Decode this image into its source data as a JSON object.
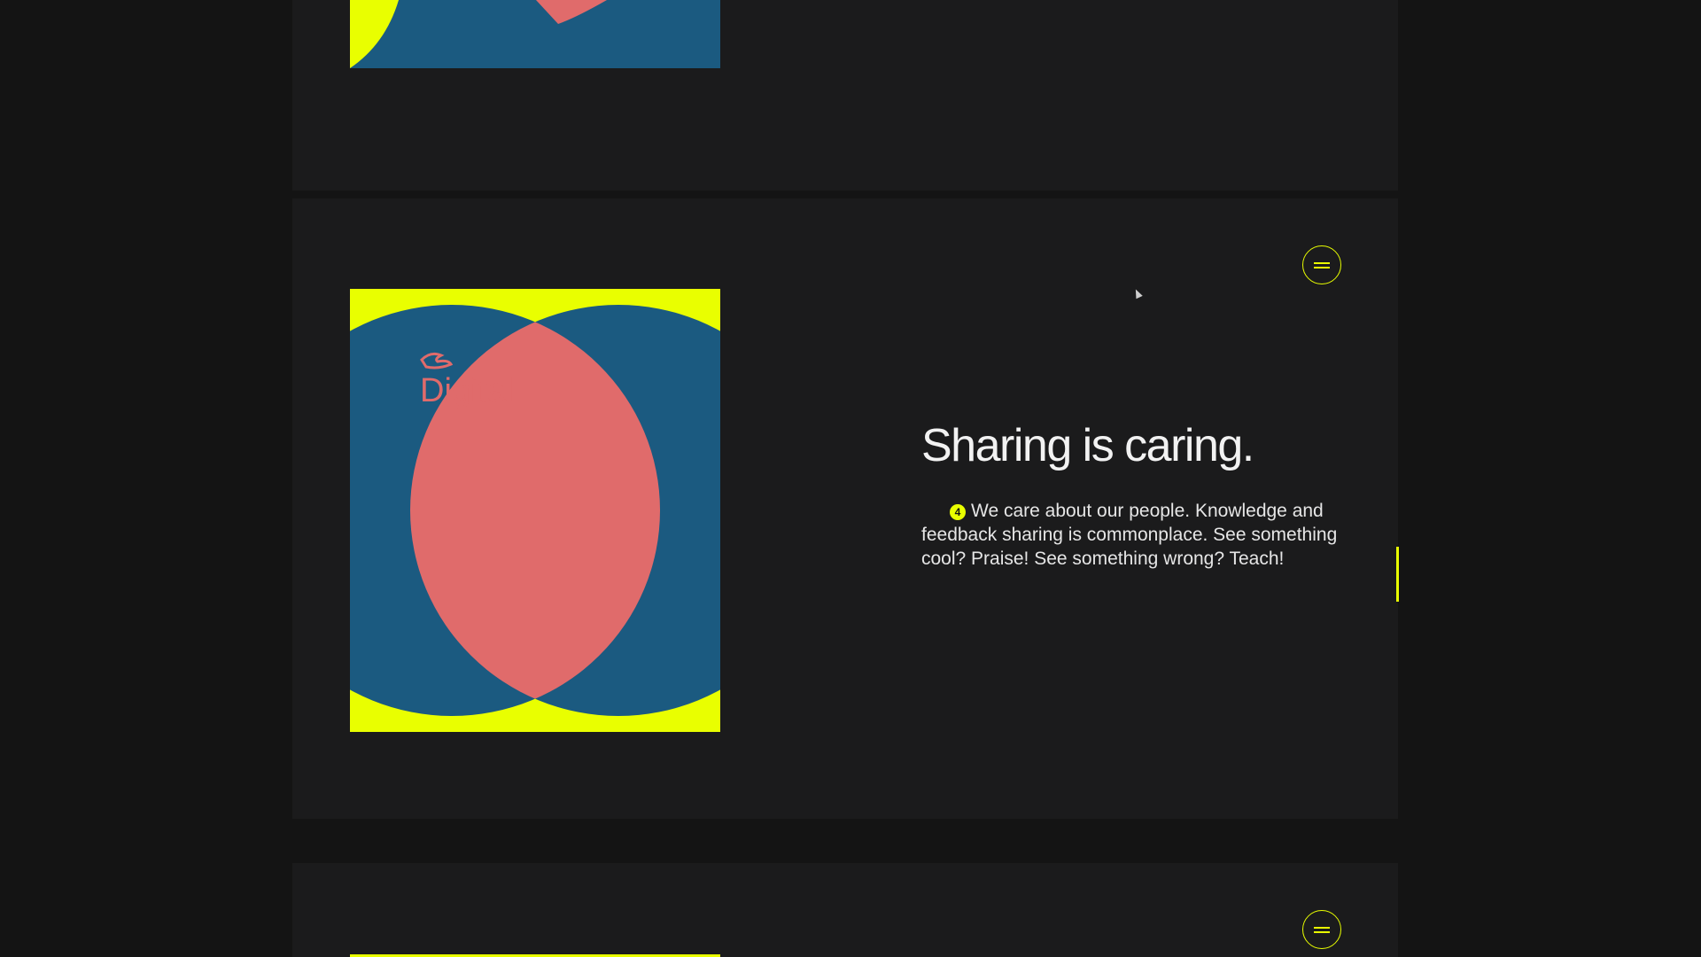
{
  "section": {
    "headline": "Sharing is caring.",
    "item_number": "4",
    "body": "We care about our people. Knowledge and feedback sharing is commonplace. See something cool? Praise! See something wrong? Teach!"
  },
  "artwork": {
    "label": "Digital",
    "icon": "hand-icon"
  },
  "colors": {
    "background": "#141414",
    "panel": "#1b1b1c",
    "accent": "#e9ff00",
    "art_blue": "#1b5a80",
    "art_coral": "#e06b6b"
  }
}
